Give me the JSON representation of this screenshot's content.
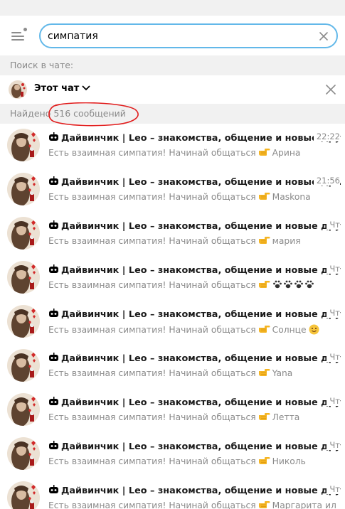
{
  "search": {
    "query": "симпатия"
  },
  "labels": {
    "search_in_chat": "Поиск в чате:",
    "found_prefix": "Найдено",
    "found_count": "516 сообщений"
  },
  "chat_filter": {
    "label": "Этот чат"
  },
  "colors": {
    "accent_border": "#62b8e9",
    "muted_text": "#8a8a8a",
    "annotation": "#e11d1d"
  },
  "icons": [
    "menu-icon",
    "search-clear-icon",
    "chevron-down-icon",
    "close-icon",
    "bot-icon",
    "pointing-hand-emoji",
    "paw-emoji",
    "smile-emoji"
  ],
  "results": [
    {
      "title": "Дайвинчик | Leo – знакомства, общение и новые дру...",
      "time": "22:22",
      "preview": "Есть взаимная симпатия! Начинай общаться",
      "sender": "Арина"
    },
    {
      "title": "Дайвинчик | Leo – знакомства, общение и новые др...",
      "time": "21:56",
      "preview": "Есть взаимная симпатия! Начинай общаться",
      "sender": "Maskona"
    },
    {
      "title": "Дайвинчик | Leo – знакомства, общение и новые друзья",
      "time": "Чт",
      "preview": "Есть взаимная симпатия! Начинай общаться",
      "sender": "мария"
    },
    {
      "title": "Дайвинчик | Leo – знакомства, общение и новые друзья",
      "time": "Чт",
      "preview": "Есть взаимная симпатия! Начинай общаться",
      "sender": "",
      "paws": true
    },
    {
      "title": "Дайвинчик | Leo – знакомства, общение и новые друзья",
      "time": "Чт",
      "preview": "Есть взаимная симпатия! Начинай общаться",
      "sender": "Солнце",
      "smile": true
    },
    {
      "title": "Дайвинчик | Leo – знакомства, общение и новые друзья",
      "time": "Чт",
      "preview": "Есть взаимная симпатия! Начинай общаться",
      "sender": "Yana"
    },
    {
      "title": "Дайвинчик | Leo – знакомства, общение и новые друзья",
      "time": "Чт",
      "preview": "Есть взаимная симпатия! Начинай общаться",
      "sender": "Летта"
    },
    {
      "title": "Дайвинчик | Leo – знакомства, общение и новые друзья",
      "time": "Чт",
      "preview": "Есть взаимная симпатия! Начинай общаться",
      "sender": "Николь"
    },
    {
      "title": "Дайвинчик | Leo – знакомства, общение и новые друзья",
      "time": "Чт",
      "preview": "Есть взаимная симпатия! Начинай общаться",
      "sender": "Маргарита или"
    }
  ]
}
